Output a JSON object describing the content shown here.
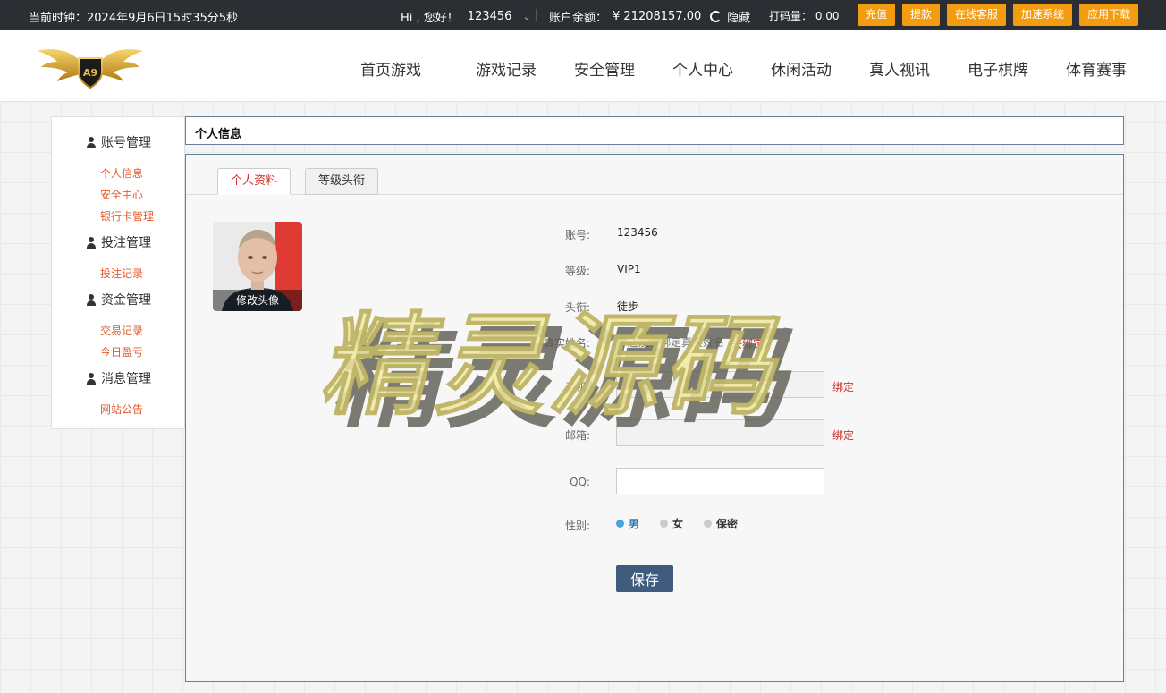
{
  "topbar": {
    "clock": "当前时钟：2024年9月6日15时35分5秒",
    "greeting": "Hi , 您好！",
    "username": "123456",
    "balance_label": "账户余额：",
    "balance_value": "¥ 21208157.00",
    "hide_label": "隐藏",
    "bet_label": "打码量：",
    "bet_value": "0.00",
    "buttons": [
      "充值",
      "提款",
      "在线客服",
      "加速系统",
      "应用下载"
    ]
  },
  "logo": {
    "text": "A9",
    "accent": "#d4a017"
  },
  "nav": [
    "首页游戏",
    "游戏记录",
    "安全管理",
    "个人中心",
    "休闲活动",
    "真人视讯",
    "电子棋牌",
    "体育赛事"
  ],
  "sidebar": {
    "groups": [
      {
        "title": "账号管理",
        "links": [
          "个人信息",
          "安全中心",
          "银行卡管理"
        ]
      },
      {
        "title": "投注管理",
        "links": [
          "投注记录"
        ]
      },
      {
        "title": "资金管理",
        "links": [
          "交易记录",
          "今日盈亏"
        ]
      },
      {
        "title": "消息管理",
        "links": [
          "网站公告"
        ]
      }
    ]
  },
  "page_title": "个人信息",
  "tabs": [
    "个人资料",
    "等级头衔"
  ],
  "avatar": {
    "caption": "修改头像"
  },
  "profile": {
    "account_label": "账号:",
    "account_value": "123456",
    "level_label": "等级:",
    "level_value": "VIP1",
    "title_label": "头衔:",
    "title_value": "徒步",
    "realname_label": "真实姓名:",
    "realname_value": "你还没有绑定真实姓名",
    "realname_link": "去绑定",
    "phone_label": "手机:",
    "phone_link": "绑定",
    "email_label": "邮箱:",
    "email_link": "绑定",
    "qq_label": "QQ:",
    "gender_label": "性别:",
    "gender_options": [
      "男",
      "女",
      "保密"
    ],
    "gender_selected": "男"
  },
  "save_label": "保存",
  "watermark": "精灵源码",
  "colors": {
    "topbar_bg": "#2b2f33",
    "button_orange": "#f39c12",
    "link_red": "#d0322b",
    "save_bg": "#3f5b7d",
    "radio_active": "#4aa3df"
  }
}
